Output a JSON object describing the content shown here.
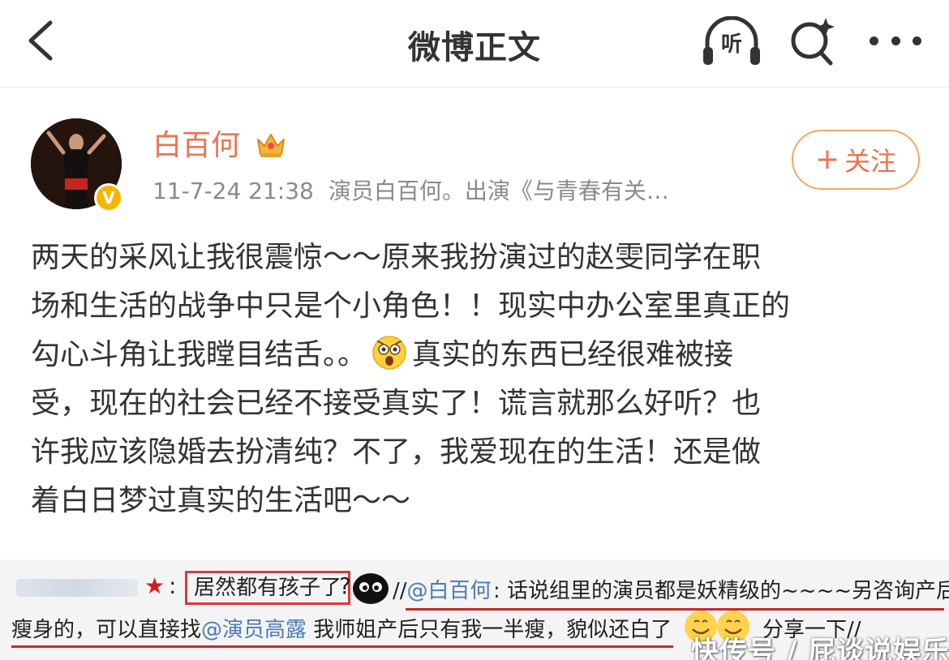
{
  "header": {
    "title": "微博正文",
    "listen_label": "听"
  },
  "post": {
    "author": {
      "name": "白百何",
      "verified_badge": "V",
      "crown_icon": "crown-icon"
    },
    "time": "11-7-24 21:38",
    "bio": "演员白百何。出演《与青春有关…",
    "follow": {
      "plus": "+",
      "label": "关注"
    },
    "text_lines": [
      "两天的采风让我很震惊～～原来我扮演过的赵雯同学在职",
      "场和生活的战争中只是个小角色！！现实中办公室里真正的",
      "勾心斗角让我瞠目结舌。。",
      "真实的东西已经很难被接",
      "受，现在的社会已经不接受真实了！谎言就那么好听？也",
      "许我应该隐婚去扮清纯？不了，我爱现在的生活！还是做",
      "着白日梦过真实的生活吧～～"
    ]
  },
  "embedded": {
    "colon": ":",
    "boxed_text": "居然都有孩子了",
    "qmark": "?",
    "slash": "//",
    "mention1": "@白百何",
    "reply_text": ": 话说组里的演员都是妖精级的~~~~另咨询产后",
    "row2_prefix": "瘦身的，可以直接找",
    "mention2": "@演员高露",
    "row2_suffix": " 我师姐产后只有我一半瘦，貌似还白了",
    "tail": "分享一下//"
  },
  "watermark": "快传号 / 屁谈说娱乐",
  "colors": {
    "accent": "#eb7350",
    "verified": "#f7b500",
    "mention": "#4a7bb5",
    "underline": "#c62a2a"
  }
}
